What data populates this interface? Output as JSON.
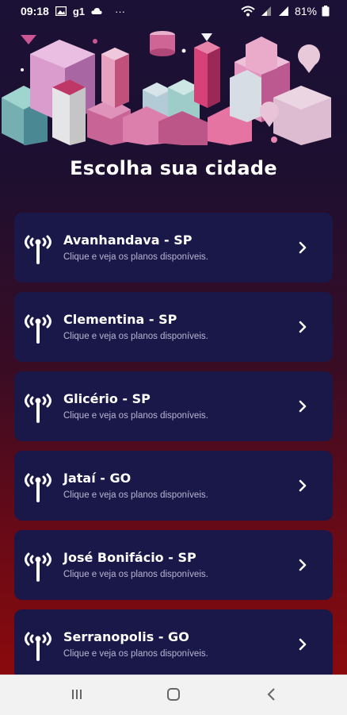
{
  "status_bar": {
    "time": "09:18",
    "carrier_label": "g1",
    "more": "···",
    "battery": "81%"
  },
  "page": {
    "title": "Escolha sua cidade"
  },
  "cities": [
    {
      "name": "Avanhandava - SP",
      "subtitle": "Clique e veja os planos disponíveis."
    },
    {
      "name": "Clementina - SP",
      "subtitle": "Clique e veja os planos disponíveis."
    },
    {
      "name": "Glicério - SP",
      "subtitle": "Clique e veja os planos disponíveis."
    },
    {
      "name": "Jataí - GO",
      "subtitle": "Clique e veja os planos disponíveis."
    },
    {
      "name": "José Bonifácio - SP",
      "subtitle": "Clique e veja os planos disponíveis."
    },
    {
      "name": "Serranopolis - GO",
      "subtitle": "Clique e veja os planos disponíveis."
    }
  ],
  "icons": {
    "city_item": "antenna-icon",
    "city_chevron": "chevron-right-icon",
    "nav_recents": "recents-icon",
    "nav_home": "home-icon",
    "nav_back": "back-icon"
  },
  "colors": {
    "card_bg": "#1a1749",
    "bg_top": "#1b1136",
    "bg_bottom": "#8a0a0d",
    "accent_pink": "#d65a9a"
  }
}
